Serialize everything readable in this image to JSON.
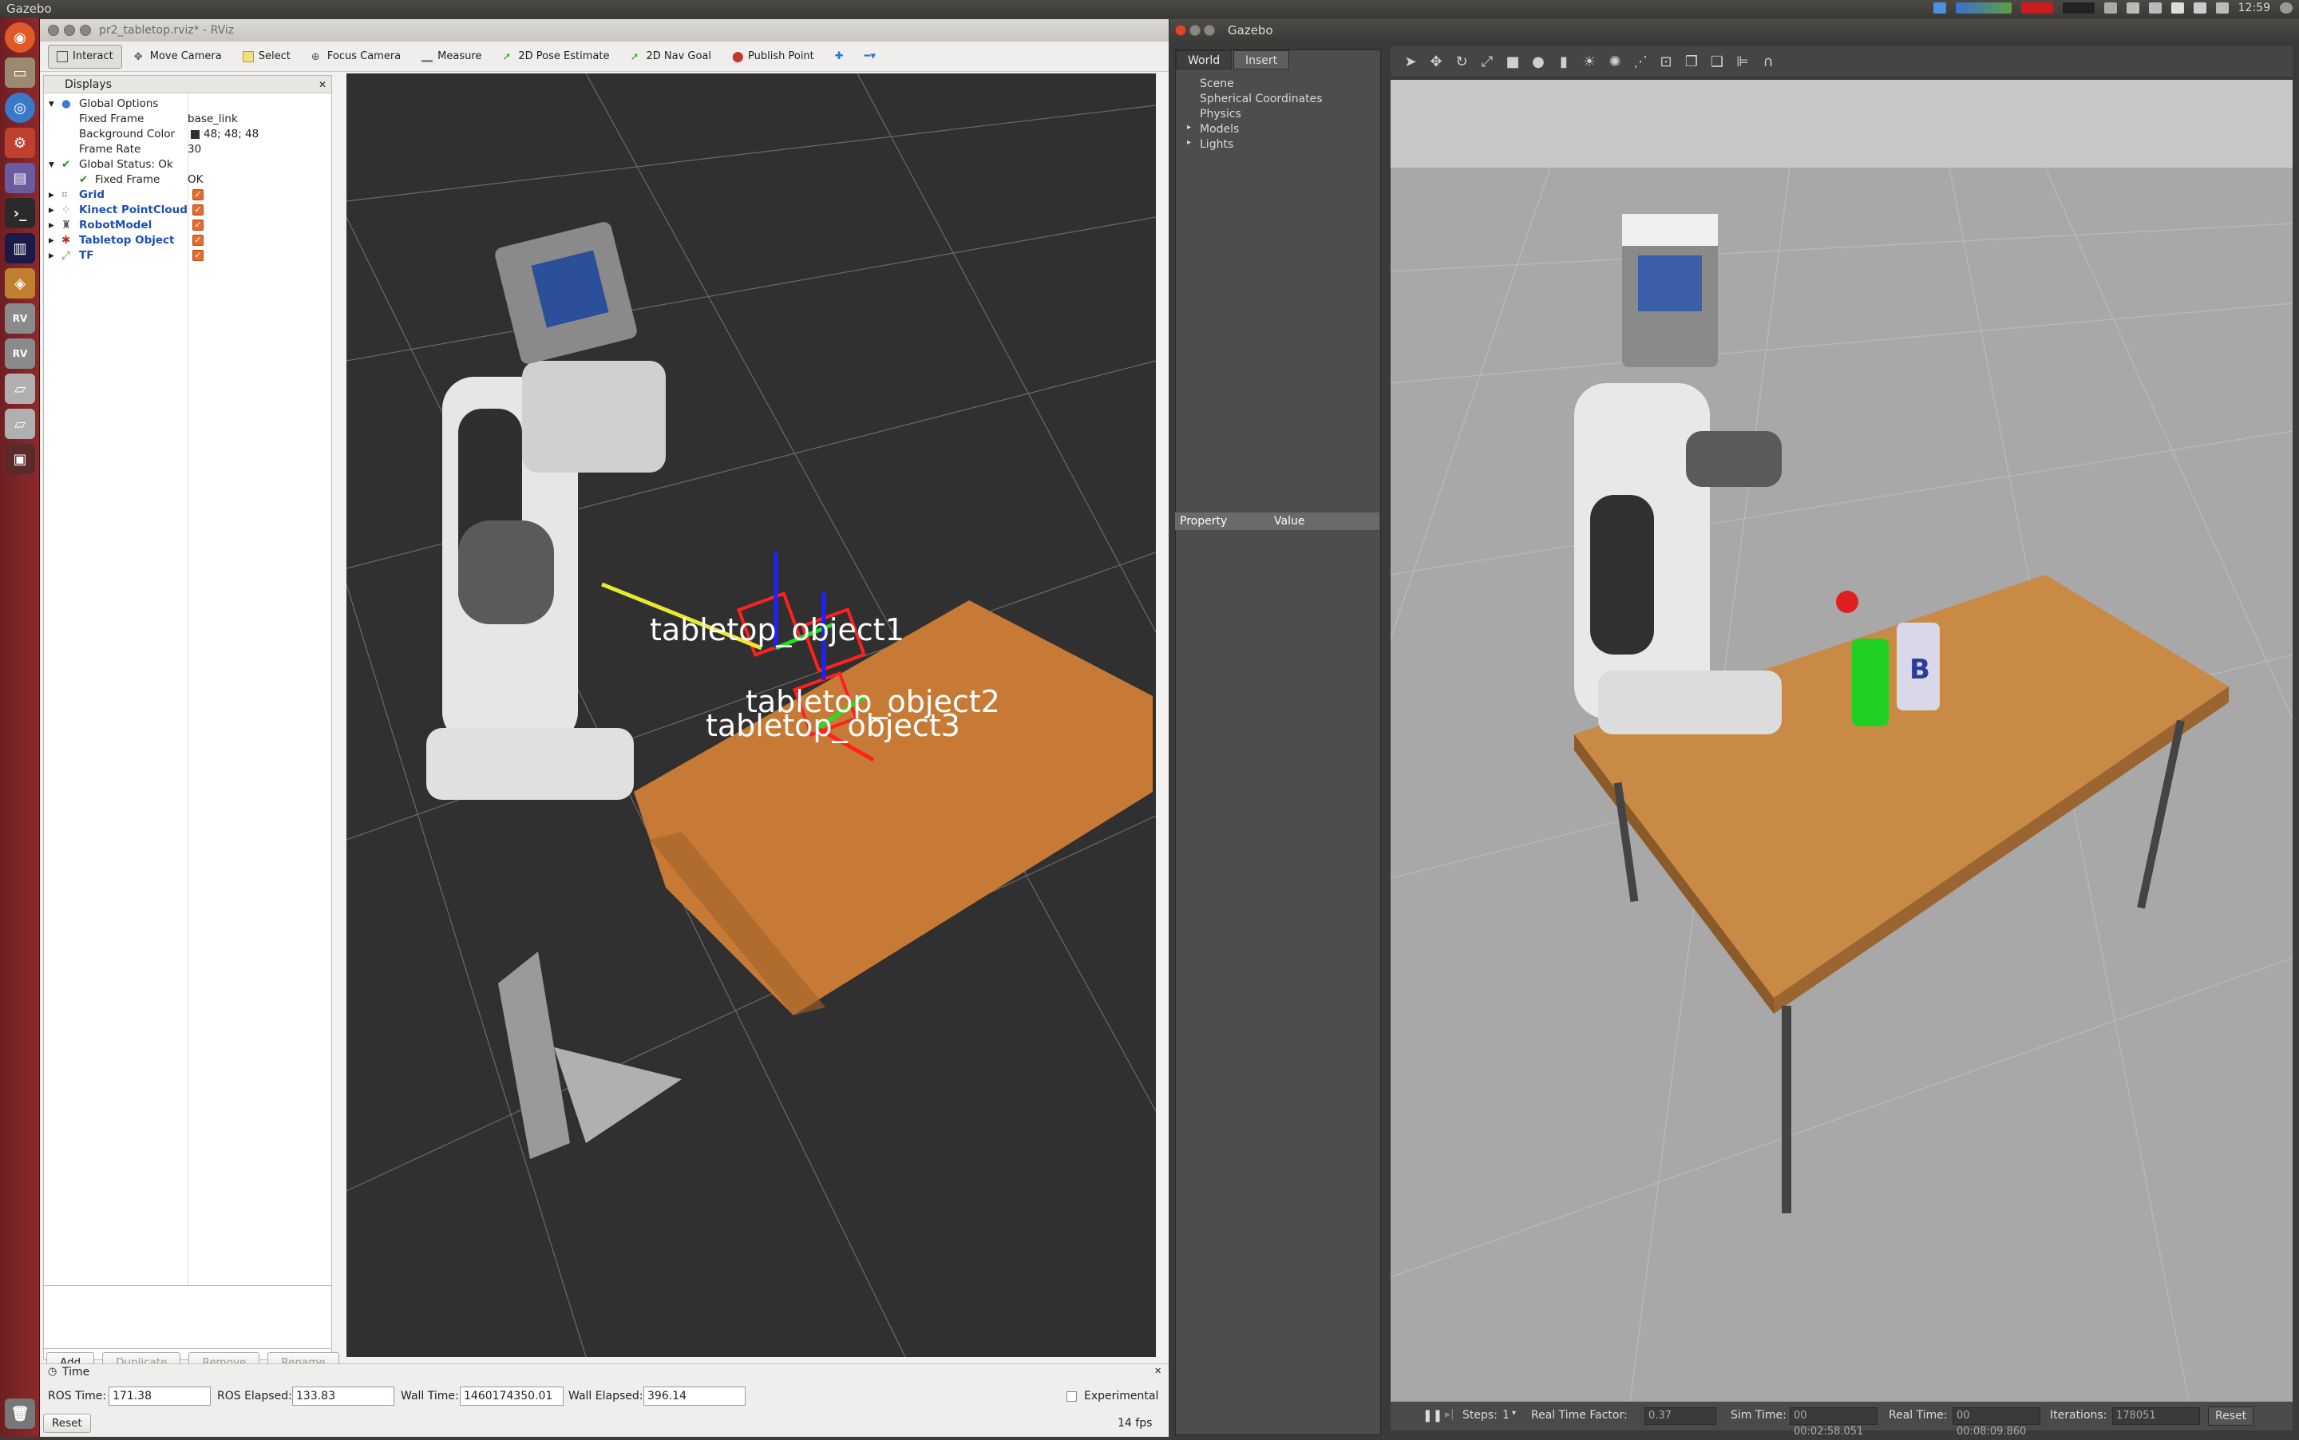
{
  "topbar": {
    "title": "Gazebo",
    "clock": "12:59"
  },
  "rviz": {
    "window_title": "pr2_tabletop.rviz* - RViz",
    "toolbar": [
      "Interact",
      "Move Camera",
      "Select",
      "Focus Camera",
      "Measure",
      "2D Pose Estimate",
      "2D Nav Goal",
      "Publish Point"
    ],
    "displays_title": "Displays",
    "tree": {
      "global_options": "Global Options",
      "fixed_frame_label": "Fixed Frame",
      "fixed_frame_value": "base_link",
      "background_color_label": "Background Color",
      "background_color_value": "48; 48; 48",
      "frame_rate_label": "Frame Rate",
      "frame_rate_value": "30",
      "global_status": "Global Status: Ok",
      "status_fixed_frame": "Fixed Frame",
      "status_fixed_frame_value": "OK",
      "grid": "Grid",
      "kinect": "Kinect PointCloud",
      "robot_model": "RobotModel",
      "tabletop": "Tabletop Object",
      "tf": "TF"
    },
    "buttons": {
      "add": "Add",
      "duplicate": "Duplicate",
      "remove": "Remove",
      "rename": "Rename"
    },
    "viewport_labels": [
      "tabletop_object1",
      "tabletop_object2",
      "tabletop_object3"
    ],
    "time_panel": {
      "title": "Time",
      "ros_time_label": "ROS Time:",
      "ros_time": "171.38",
      "ros_elapsed_label": "ROS Elapsed:",
      "ros_elapsed": "133.83",
      "wall_time_label": "Wall Time:",
      "wall_time": "1460174350.01",
      "wall_elapsed_label": "Wall Elapsed:",
      "wall_elapsed": "396.14",
      "experimental": "Experimental",
      "reset": "Reset",
      "fps": "14 fps"
    }
  },
  "gazebo": {
    "window_title": "Gazebo",
    "tabs": [
      "World",
      "Insert"
    ],
    "world_items": [
      "Scene",
      "Spherical Coordinates",
      "Physics",
      "Models",
      "Lights"
    ],
    "property_header": {
      "property": "Property",
      "value": "Value"
    },
    "status": {
      "steps_label": "Steps:",
      "steps": "1",
      "rtf_label": "Real Time Factor:",
      "rtf": "0.37",
      "sim_time_label": "Sim Time:",
      "sim_time": "00 00:02:58.051",
      "real_time_label": "Real Time:",
      "real_time": "00 00:08:09.860",
      "iterations_label": "Iterations:",
      "iterations": "178051",
      "reset": "Reset"
    }
  },
  "colors": {
    "rviz_bg": "#303030",
    "gazebo_bg": "#a8a8a8",
    "launcher": "#8c2a2c",
    "checkbox": "#e86a2c"
  }
}
